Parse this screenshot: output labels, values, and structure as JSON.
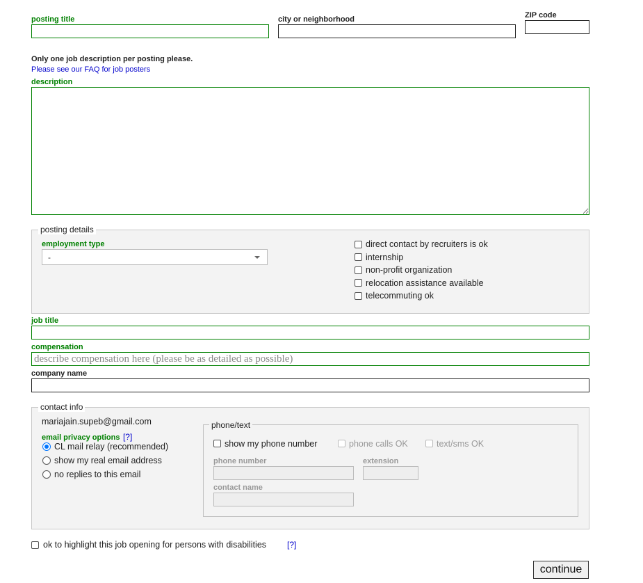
{
  "fields": {
    "posting_title": {
      "label": "posting title",
      "value": ""
    },
    "city": {
      "label": "city or neighborhood",
      "value": ""
    },
    "zip": {
      "label": "ZIP code",
      "value": ""
    },
    "description": {
      "label": "description",
      "value": ""
    },
    "job_title": {
      "label": "job title",
      "value": ""
    },
    "compensation": {
      "label": "compensation",
      "placeholder": "describe compensation here (please be as detailed as possible)"
    },
    "company_name": {
      "label": "company name",
      "value": ""
    }
  },
  "notice": {
    "warning": "Only one job description per posting please.",
    "faq_link": "Please see our FAQ for job posters"
  },
  "posting_details": {
    "legend": "posting details",
    "employment_type_label": "employment type",
    "employment_type_value": "-",
    "checkboxes": [
      {
        "label": "direct contact by recruiters is ok",
        "checked": false
      },
      {
        "label": "internship",
        "checked": false
      },
      {
        "label": "non-profit organization",
        "checked": false
      },
      {
        "label": "relocation assistance available",
        "checked": false
      },
      {
        "label": "telecommuting ok",
        "checked": false
      }
    ]
  },
  "contact_info": {
    "legend": "contact info",
    "email": "mariajain.supeb@gmail.com",
    "privacy_label": "email privacy options",
    "help": "[?]",
    "privacy_options": [
      {
        "label": "CL mail relay (recommended)",
        "selected": true
      },
      {
        "label": "show my real email address",
        "selected": false
      },
      {
        "label": "no replies to this email",
        "selected": false
      }
    ],
    "phone": {
      "legend": "phone/text",
      "show_phone": "show my phone number",
      "calls_ok": "phone calls OK",
      "sms_ok": "text/sms OK",
      "phone_number_label": "phone number",
      "extension_label": "extension",
      "contact_name_label": "contact name"
    }
  },
  "disability": {
    "label": "ok to highlight this job opening for persons with disabilities",
    "help": "[?]"
  },
  "continue_label": "continue",
  "colors": {
    "required": "#008000",
    "link": "#0000cc",
    "fieldset_bg": "#f3f3f3",
    "radio_accent": "#0075ff"
  }
}
